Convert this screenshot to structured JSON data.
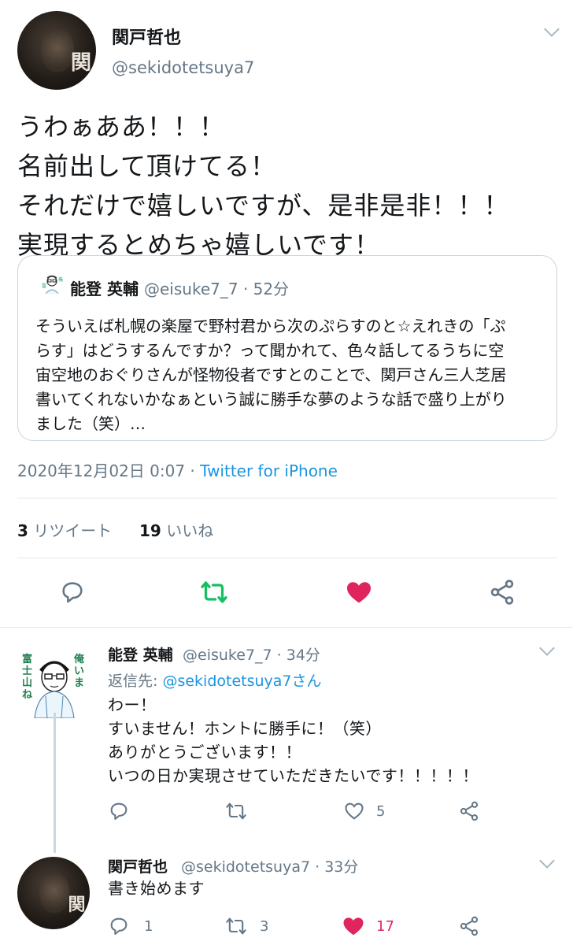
{
  "main_tweet": {
    "author_name": "関戸哲也",
    "author_handle": "@sekidotetsuya7",
    "avatar_mark": "関",
    "text_lines": [
      "うわぁああ！！！",
      "名前出して頂けてる！",
      "それだけで嬉しいですが、是非是非！！！",
      "実現するとめちゃ嬉しいです！"
    ],
    "quoted": {
      "author_name": "能登 英輔",
      "author_handle": "@eisuke7_7",
      "time": "52分",
      "text_lines": [
        "そういえば札幌の楽屋で野村君から次のぷらすのと☆えれきの「ぷ",
        "らす」はどうするんですか？って聞かれて、色々話してるうちに空",
        "宙空地のおぐりさんが怪物役者ですとのことで、関戸さん三人芝居",
        "書いてくれないかなぁという誠に勝手な夢のような話で盛り上がり",
        "ました（笑）…"
      ]
    },
    "timestamp": "2020年12月02日 0:07",
    "source": "Twitter for iPhone",
    "retweet_count": "3",
    "retweet_label": "リツイート",
    "like_count": "19",
    "like_label": "いいね"
  },
  "replies": [
    {
      "author_name": "能登 英輔",
      "author_handle": "@eisuke7_7",
      "time": "34分",
      "reply_to_prefix": "返信先: ",
      "reply_to_mention": "@sekidotetsuya7さん",
      "avatar_text": [
        "俺いま",
        "富士山ね"
      ],
      "text_lines": [
        "わー！",
        "すいません！ホントに勝手に！（笑）",
        "ありがとうございます！！",
        "いつの日か実現させていただきたいです！！！！！"
      ],
      "reply_count": "",
      "retweet_count": "",
      "like_count": "5",
      "liked": false
    },
    {
      "author_name": "関戸哲也",
      "author_handle": "@sekidotetsuya7",
      "time": "33分",
      "avatar_mark": "関",
      "text_lines": [
        "書き始めます"
      ],
      "reply_count": "1",
      "retweet_count": "3",
      "like_count": "17",
      "liked": true
    }
  ],
  "colors": {
    "text": "#14171a",
    "secondary": "#657786",
    "link": "#1b95e0",
    "retweet_green": "#17bf63",
    "like_red": "#e0245e",
    "divider": "#e1e8ed"
  },
  "icons": [
    "reply-icon",
    "retweet-icon",
    "like-icon",
    "share-icon",
    "chevron-down-icon"
  ]
}
